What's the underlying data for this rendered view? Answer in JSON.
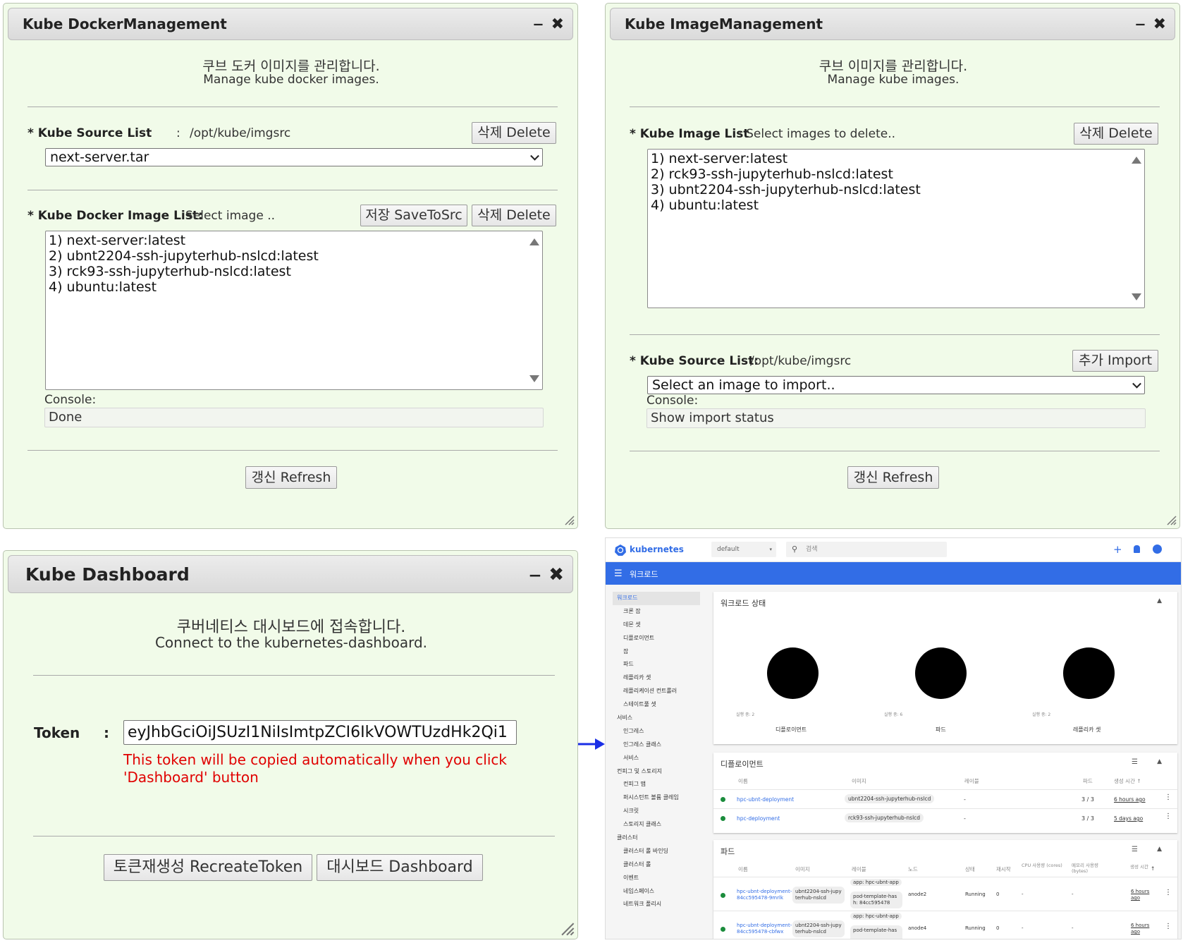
{
  "docker_win": {
    "title": "Kube DockerManagement",
    "desc_ko": "쿠브 도커 이미지를 관리합니다.",
    "desc_en": "Manage kube docker images.",
    "source_label": "* Kube Source List",
    "source_colon": ":",
    "source_path": "/opt/kube/imgsrc",
    "source_delete": "삭제 Delete",
    "source_selected": "next-server.tar",
    "image_label": "* Kube Docker Image List:",
    "image_hint": "Select image ..",
    "save_btn": "저장 SaveToSrc",
    "image_delete": "삭제 Delete",
    "images": [
      "1) next-server:latest",
      "2) ubnt2204-ssh-jupyterhub-nslcd:latest",
      "3) rck93-ssh-jupyterhub-nslcd:latest",
      "4) ubuntu:latest"
    ],
    "console_label": "Console:",
    "console_value": "Done",
    "refresh": "갱신 Refresh"
  },
  "image_win": {
    "title": "Kube ImageManagement",
    "desc_ko": "쿠브 이미지를 관리합니다.",
    "desc_en": "Manage kube images.",
    "image_label": "* Kube Image List",
    "image_hint": ": Select images to delete..",
    "image_delete": "삭제 Delete",
    "images": [
      "1) next-server:latest",
      "2) rck93-ssh-jupyterhub-nslcd:latest",
      "3) ubnt2204-ssh-jupyterhub-nslcd:latest",
      "4) ubuntu:latest"
    ],
    "source_label": "* Kube Source List:",
    "source_path": "/opt/kube/imgsrc",
    "import_btn": "추가 Import",
    "import_select": "Select an image to import..",
    "console_label": "Console:",
    "console_value": "Show import status",
    "refresh": "갱신 Refresh"
  },
  "dash_win": {
    "title": "Kube Dashboard",
    "desc_ko": "쿠버네티스 대시보드에 접속합니다.",
    "desc_en": "Connect to the kubernetes-dashboard.",
    "token_label": "Token",
    "token_colon": ":",
    "token_value": "eyJhbGciOiJSUzI1NiIsImtpZCI6IkVOWTUzdHk2Qi1",
    "note_line1": "This token will be copied automatically when you click",
    "note_line2": "'Dashboard' button",
    "recreate_btn": "토큰재생성 RecreateToken",
    "dashboard_btn": "대시보드 Dashboard"
  },
  "k8s": {
    "brand": "kubernetes",
    "namespace": "default",
    "search_placeholder": "검색",
    "bar_title": "워크로드",
    "sidebar": [
      "워크로드",
      "크론 잡",
      "데몬 셋",
      "디플로이먼트",
      "잡",
      "파드",
      "레플리카 셋",
      "레플리케이션 컨트롤러",
      "스테이트풀 셋",
      "서비스",
      "인그레스",
      "인그레스 클래스",
      "서비스",
      "컨피그 및 스토리지",
      "컨피그 맵",
      "퍼시스턴트 볼륨 클레임",
      "시크릿",
      "스토리지 클래스",
      "클러스터",
      "클러스터 롤 바인딩",
      "클러스터 롤",
      "이벤트",
      "네임스페이스",
      "네트워크 폴리시"
    ],
    "status_title": "워크로드 상태",
    "status": [
      {
        "caption": "실행 중: 2",
        "name": "디플로이먼트"
      },
      {
        "caption": "실행 중: 6",
        "name": "파드"
      },
      {
        "caption": "실행 중: 2",
        "name": "레플리카 셋"
      }
    ],
    "deploy_title": "디플로이먼트",
    "deploy_cols": [
      "이름",
      "이미지",
      "레이블",
      "파드",
      "생성 시간 ↑"
    ],
    "deploy_rows": [
      {
        "name": "hpc-ubnt-deployment",
        "image": "ubnt2204-ssh-jupyterhub-nslcd",
        "label": "-",
        "pods": "3 / 3",
        "age": "6 hours ago"
      },
      {
        "name": "hpc-deployment",
        "image": "rck93-ssh-jupyterhub-nslcd",
        "label": "-",
        "pods": "3 / 3",
        "age": "5 days ago"
      }
    ],
    "pods_title": "파드",
    "pod_cols": [
      "이름",
      "이미지",
      "레이블",
      "노드",
      "상태",
      "재시작",
      "CPU 사용량 (cores)",
      "메모리 사용량 (bytes)",
      "생성 시간"
    ],
    "pod_rows": [
      {
        "name1": "hpc-ubnt-deployment-",
        "name2": "84cc595478-9mrlk",
        "image1": "ubnt2204-ssh-jupy",
        "image2": "terhub-nslcd",
        "label1": "app: hpc-ubnt-app",
        "label2": "pod-template-has",
        "label3": "h: 84cc595478",
        "node": "anode2",
        "status": "Running",
        "restarts": "0",
        "cpu": "-",
        "mem": "-",
        "age1": "6 hours",
        "age2": "ago"
      },
      {
        "name1": "hpc-ubnt-deployment-",
        "name2": "84cc595478-cbfwx",
        "image1": "ubnt2204-ssh-jupy",
        "image2": "terhub-nslcd",
        "label1": "app: hpc-ubnt-app",
        "label2": "pod-template-has",
        "label3": "",
        "node": "anode4",
        "status": "Running",
        "restarts": "0",
        "cpu": "-",
        "mem": "-",
        "age1": "6 hours",
        "age2": "ago"
      }
    ]
  },
  "colors": {
    "window_bg": "#f1fbe9",
    "k8s_blue": "#326de6",
    "note_red": "#e00000",
    "arrow": "#1a2ee6"
  }
}
